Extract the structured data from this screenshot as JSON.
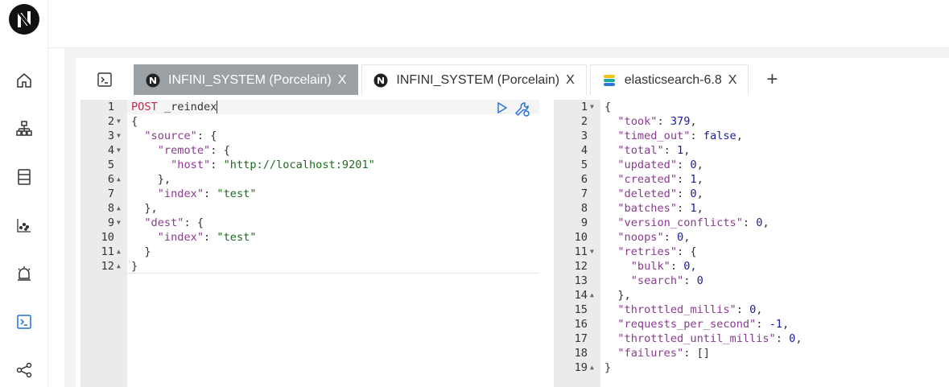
{
  "tabs": [
    {
      "label": "INFINI_SYSTEM (Porcelain)",
      "active": true,
      "icon": "infini-logo-icon"
    },
    {
      "label": "INFINI_SYSTEM (Porcelain)",
      "active": false,
      "icon": "infini-logo-icon"
    },
    {
      "label": "elasticsearch-6.8",
      "active": false,
      "icon": "elasticsearch-logo-icon"
    }
  ],
  "close_glyph": "X",
  "add_glyph": "+",
  "request": {
    "method": "POST",
    "endpoint": "_reindex",
    "lines": [
      "POST _reindex",
      "{",
      "  \"source\": {",
      "    \"remote\": {",
      "      \"host\": \"http://localhost:9201\"",
      "    },",
      "    \"index\": \"test\"",
      "  },",
      "  \"dest\": {",
      "    \"index\": \"test\"",
      "  }",
      "}"
    ]
  },
  "response": {
    "lines": [
      "{",
      "  \"took\": 379,",
      "  \"timed_out\": false,",
      "  \"total\": 1,",
      "  \"updated\": 0,",
      "  \"created\": 1,",
      "  \"deleted\": 0,",
      "  \"batches\": 1,",
      "  \"version_conflicts\": 0,",
      "  \"noops\": 0,",
      "  \"retries\": {",
      "    \"bulk\": 0,",
      "    \"search\": 0",
      "  },",
      "  \"throttled_millis\": 0,",
      "  \"requests_per_second\": -1,",
      "  \"throttled_until_millis\": 0,",
      "  \"failures\": []",
      "}"
    ]
  },
  "sidebar": {
    "items": [
      "home-icon",
      "cluster-icon",
      "data-icon",
      "metrics-icon",
      "alerting-icon",
      "console-icon",
      "share-icon"
    ]
  }
}
